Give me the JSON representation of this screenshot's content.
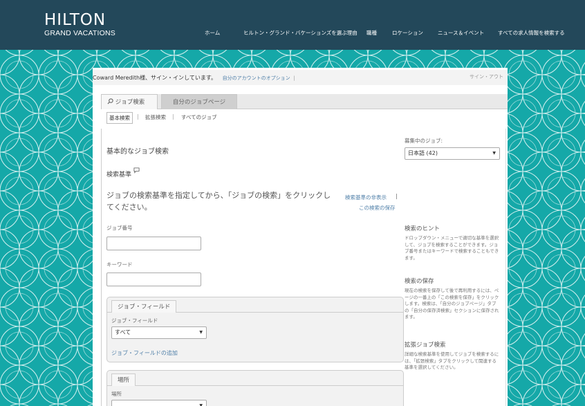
{
  "brand": {
    "logo_main": "HILTON",
    "logo_sub": "GRAND VACATIONS"
  },
  "nav": {
    "items": [
      "ホーム",
      "ヒルトン・グランド・バケーションズを選ぶ理由",
      "職種",
      "ロケーション",
      "ニュース＆イベント",
      "すべての求人情報を検索する"
    ]
  },
  "account": {
    "welcome": "Coward Meredith様、サイン・インしています。",
    "options_link": "自分のアカウントのオプション",
    "separator": "|",
    "signout": "サイン・アウト"
  },
  "tabs": {
    "job_search": "ジョブ検索",
    "my_job_page": "自分のジョブページ"
  },
  "subtabs": {
    "basic": "基本検索",
    "advanced": "拡張検索",
    "all_jobs": "すべてのジョブ",
    "separator": "|"
  },
  "search": {
    "heading": "基本的なジョブ検索",
    "criteria_label": "検索基準",
    "instruction": "ジョブの検索基準を指定してから、「ジョブの検索」をクリックしてください。",
    "hide_criteria_link": "検索基準の非表示",
    "save_search_link": "この検索の保存",
    "link_separator": "|",
    "job_number_label": "ジョブ番号",
    "job_number_value": "",
    "keyword_label": "キーワード",
    "keyword_value": ""
  },
  "recruiting": {
    "label": "募集中のジョブ:",
    "selected": "日本語 (42)"
  },
  "job_field_panel": {
    "tab_label": "ジョブ・フィールド",
    "field_label": "ジョブ・フィールド",
    "selected": "すべて",
    "add_link": "ジョブ・フィールドの追加"
  },
  "location_panel": {
    "tab_label": "場所",
    "field_label": "場所"
  },
  "sidebar": {
    "tips_heading": "検索のヒント",
    "tips_text": "ドロップダウン・メニューで適切な基準を選択して、ジョブを検索することができます。ジョブ番号またはキーワードで検索することもできます。",
    "save_heading": "検索の保存",
    "save_text": "現在の検索を保存して後で再利用するには、ページの一番上の「この検索を保存」をクリックします。検索は、「自分のジョブページ」タブの「自分の保存済検索」セクションに保存されます。",
    "advanced_heading": "拡張ジョブ検索",
    "advanced_text": "詳細な検索基準を使用してジョブを検索するには、「拡張検索」タブをクリックして関連する基準を選択してください。"
  },
  "colors": {
    "header_bg": "#23485a",
    "teal": "#15a8a8",
    "link": "#4f7fa8"
  },
  "icons": {
    "search": "search-icon",
    "speech_bubble": "speech-bubble-icon",
    "dropdown": "chevron-down-icon"
  }
}
